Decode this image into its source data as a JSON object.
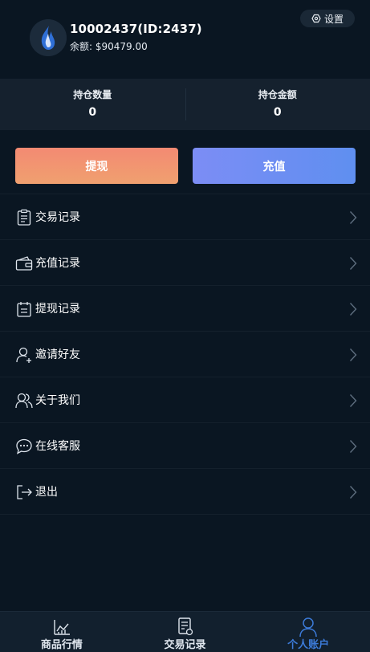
{
  "user": {
    "name": "10002437(ID:2437)",
    "balance_label": "余额:",
    "balance_value": "$90479.00"
  },
  "settings": {
    "label": "设置"
  },
  "stats": [
    {
      "label": "持仓数量",
      "value": "0"
    },
    {
      "label": "持仓金额",
      "value": "0"
    }
  ],
  "buttons": {
    "withdraw": "提现",
    "recharge": "充值"
  },
  "menu": [
    {
      "label": "交易记录",
      "icon": "clipboard-icon"
    },
    {
      "label": "充值记录",
      "icon": "wallet-icon"
    },
    {
      "label": "提现记录",
      "icon": "calendar-icon"
    },
    {
      "label": "邀请好友",
      "icon": "user-add-icon"
    },
    {
      "label": "关于我们",
      "icon": "users-icon"
    },
    {
      "label": "在线客服",
      "icon": "chat-icon"
    },
    {
      "label": "退出",
      "icon": "logout-icon"
    }
  ],
  "tabs": [
    {
      "label": "商品行情",
      "icon": "chart-icon",
      "active": false
    },
    {
      "label": "交易记录",
      "icon": "receipt-icon",
      "active": false
    },
    {
      "label": "个人账户",
      "icon": "person-icon",
      "active": true
    }
  ],
  "colors": {
    "background": "#0a1622",
    "stats_bg": "#15212e",
    "withdraw_gradient": [
      "#f38a73",
      "#f0a06f"
    ],
    "recharge_gradient": [
      "#7c8df5",
      "#5f8ff0"
    ],
    "active_tab": "#3c7bd9"
  }
}
